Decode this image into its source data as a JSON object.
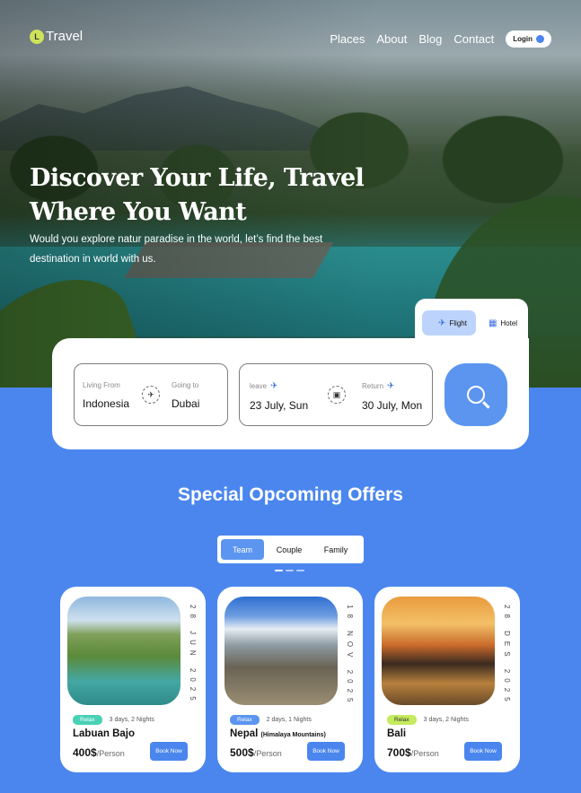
{
  "brand": {
    "logo_mark": "L",
    "name": "Travel"
  },
  "nav": {
    "items": [
      "Places",
      "About",
      "Blog",
      "Contact"
    ],
    "login": "Login"
  },
  "hero": {
    "title_line1": "Discover Your Life, Travel",
    "title_line2": "Where You Want",
    "subtitle": "Would you explore natur paradise in the world, let’s find the best destination in world with us."
  },
  "booking": {
    "modes": [
      {
        "label": "Flight",
        "icon": "plane-icon",
        "active": true
      },
      {
        "label": "Hotel",
        "icon": "hotel-icon",
        "active": false
      }
    ],
    "from": {
      "label": "Living From",
      "value": "Indonesia"
    },
    "to": {
      "label": "Going to",
      "value": "Dubai"
    },
    "leave": {
      "label": "leave",
      "value": "23 July, Sun"
    },
    "return": {
      "label": "Return",
      "value": "30 July, Mon"
    },
    "search_icon": "search-icon"
  },
  "offers": {
    "title": "Special Opcoming Offers",
    "filters": [
      "Team",
      "Couple",
      "Family"
    ],
    "active_filter": "Team",
    "cards": [
      {
        "date": "28 JUN 2025",
        "tag": "Relax",
        "duration": "3 days, 2 Nights",
        "place": "Labuan Bajo",
        "place_note": "",
        "price": "400$",
        "per": "/Person",
        "button": "Book Now"
      },
      {
        "date": "18 NOV 2025",
        "tag": "Relax",
        "duration": "2 days, 1 Nights",
        "place": "Nepal",
        "place_note": "(Himalaya Mountains)",
        "price": "500$",
        "per": "/Person",
        "button": "Book Now"
      },
      {
        "date": "28 DES 2025",
        "tag": "Relax",
        "duration": "3 days, 2 Nights",
        "place": "Bali",
        "place_note": "",
        "price": "700$",
        "per": "/Person",
        "button": "Book Now"
      }
    ]
  },
  "colors": {
    "accent": "#4a86ee",
    "logo": "#cfe35a",
    "tag_green": "#48d1b5",
    "tag_blue": "#5b95f0",
    "tag_lime": "#c5eb5e"
  }
}
